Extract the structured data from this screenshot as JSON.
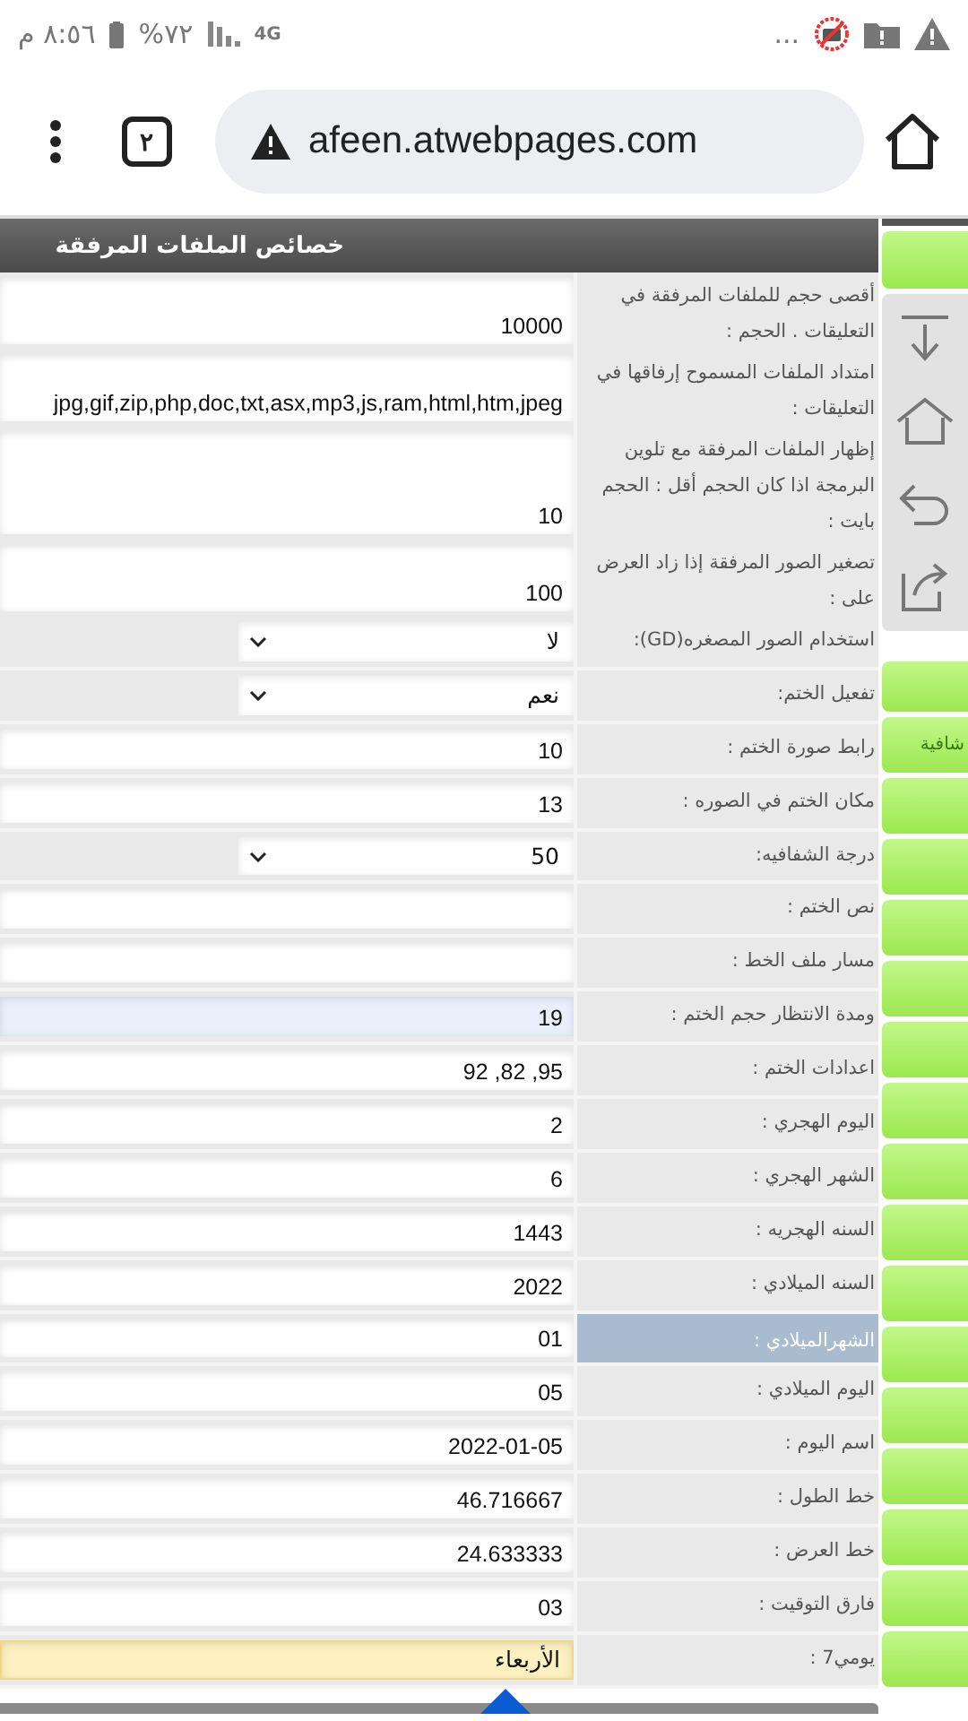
{
  "status_bar": {
    "time": "٨:٥٦ م",
    "battery": "%٧٢",
    "network": "4G",
    "more": "..."
  },
  "browser": {
    "tab_count": "٢",
    "url": "afeen.atwebpages.com"
  },
  "panel": {
    "title": "خصائص الملفات المرفقة",
    "rows": [
      {
        "label": "أقصى حجم للملفات المرفقة في التعليقات . الحجم :",
        "selected": false,
        "field": {
          "kind": "text",
          "focused": false,
          "highlighted": false,
          "value": "10000"
        }
      },
      {
        "label": "امتداد الملفات المسموح إرفاقها في التعليقات :",
        "selected": false,
        "field": {
          "kind": "text",
          "focused": false,
          "highlighted": false,
          "value": "jpg,gif,zip,php,doc,txt,asx,mp3,js,ram,html,htm,jpeg"
        }
      },
      {
        "label": "إظهار الملفات المرفقة مع تلوين البرمجة اذا كان الحجم أقل : الحجم بايت :",
        "selected": false,
        "field": {
          "kind": "text",
          "focused": false,
          "highlighted": false,
          "value": "10"
        }
      },
      {
        "label": "تصغير الصور المرفقة إذا زاد العرض على :",
        "selected": false,
        "field": {
          "kind": "text",
          "focused": false,
          "highlighted": false,
          "value": "100"
        }
      },
      {
        "label": "استخدام الصور المصغره(GD):",
        "selected": false,
        "field": {
          "kind": "select",
          "value": "لا"
        }
      },
      {
        "label": "تفعيل الختم:",
        "selected": false,
        "field": {
          "kind": "select",
          "value": "نعم"
        }
      },
      {
        "label": "رابط صورة الختم :",
        "selected": false,
        "field": {
          "kind": "text",
          "focused": false,
          "highlighted": false,
          "value": "10"
        }
      },
      {
        "label": "مكان الختم في الصوره :",
        "selected": false,
        "field": {
          "kind": "text",
          "focused": false,
          "highlighted": false,
          "value": "13"
        }
      },
      {
        "label": "درجة الشفافيه:",
        "selected": false,
        "field": {
          "kind": "select",
          "value": "50"
        }
      },
      {
        "label": "نص الختم :",
        "selected": false,
        "field": {
          "kind": "text",
          "focused": false,
          "highlighted": false
        }
      },
      {
        "label": "مسار ملف الخط :",
        "selected": false,
        "field": {
          "kind": "text",
          "focused": false,
          "highlighted": false
        }
      },
      {
        "label": "ومدة الانتظار حجم الختم :",
        "selected": false,
        "field": {
          "kind": "text",
          "focused": true,
          "highlighted": false,
          "value": "19"
        }
      },
      {
        "label": "اعدادات الختم :",
        "selected": false,
        "field": {
          "kind": "text",
          "focused": false,
          "highlighted": false,
          "value": "92 ,82 ,95"
        }
      },
      {
        "label": "اليوم الهجري :",
        "selected": false,
        "field": {
          "kind": "text",
          "focused": false,
          "highlighted": false,
          "value": "2"
        }
      },
      {
        "label": "الشهر الهجري :",
        "selected": false,
        "field": {
          "kind": "text",
          "focused": false,
          "highlighted": false,
          "value": "6"
        }
      },
      {
        "label": "السنه الهجريه :",
        "selected": false,
        "field": {
          "kind": "text",
          "focused": false,
          "highlighted": false,
          "value": "1443"
        }
      },
      {
        "label": "السنه الميلادي :",
        "selected": false,
        "field": {
          "kind": "text",
          "focused": false,
          "highlighted": false,
          "value": "2022"
        }
      },
      {
        "label": "الشهرالميلادي :",
        "selected": true,
        "field": {
          "kind": "text",
          "focused": false,
          "highlighted": false,
          "value": "01"
        }
      },
      {
        "label": "اليوم الميلادي :",
        "selected": false,
        "field": {
          "kind": "text",
          "focused": false,
          "highlighted": false,
          "value": "05"
        }
      },
      {
        "label": "اسم اليوم :",
        "selected": false,
        "field": {
          "kind": "text",
          "focused": false,
          "highlighted": false,
          "value": "2022-01-05"
        }
      },
      {
        "label": "خط الطول :",
        "selected": false,
        "field": {
          "kind": "text",
          "focused": false,
          "highlighted": false,
          "value": "46.716667"
        }
      },
      {
        "label": "خط العرض :",
        "selected": false,
        "field": {
          "kind": "text",
          "focused": false,
          "highlighted": false,
          "value": "24.633333"
        }
      },
      {
        "label": "فارق التوقيت :",
        "selected": false,
        "field": {
          "kind": "text",
          "focused": false,
          "highlighted": false,
          "value": "03"
        }
      },
      {
        "label": "يومي7 :",
        "selected": false,
        "field": {
          "kind": "text",
          "focused": false,
          "highlighted": true,
          "value": "الأربعاء"
        }
      }
    ]
  },
  "sidebar": {
    "tabs": [
      {
        "label": "شافية"
      }
    ]
  }
}
